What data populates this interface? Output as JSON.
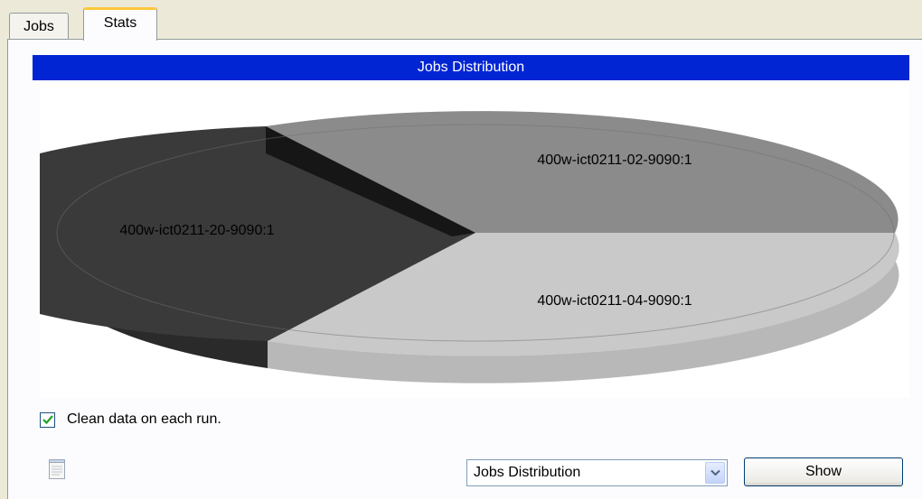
{
  "tabs": [
    {
      "label": "Jobs",
      "active": false
    },
    {
      "label": "Stats",
      "active": true
    }
  ],
  "chart_title": "Jobs Distribution",
  "chart_data": {
    "type": "pie",
    "title": "Jobs Distribution",
    "labels": [
      "400w-ict0211-02-9090:1",
      "400w-ict0211-04-9090:1",
      "400w-ict0211-20-9090:1"
    ],
    "values": [
      34,
      33,
      33
    ],
    "colors": [
      "#8b8b8b",
      "#c7c7c7",
      "#3b3b3b"
    ],
    "three_d": true
  },
  "options": {
    "clean_data_label": "Clean data on each run.",
    "clean_data_checked": true
  },
  "bottom": {
    "chart_select_value": "Jobs Distribution",
    "show_button_label": "Show"
  },
  "icons": {
    "notepad": "notepad-icon",
    "dropdown": "chevron-down-icon",
    "check": "checkmark-icon"
  }
}
